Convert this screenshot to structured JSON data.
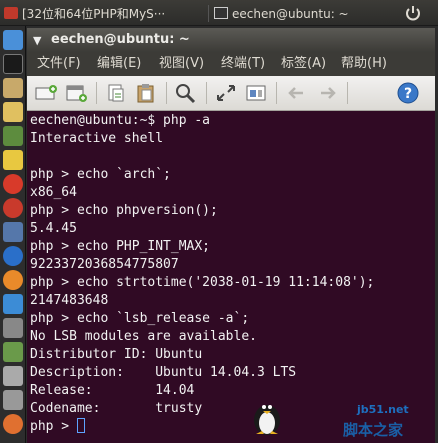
{
  "topbar": {
    "tab1_title": "[32位和64位PHP和MyS···",
    "tab2_title": "eechen@ubuntu: ~"
  },
  "window": {
    "title": "eechen@ubuntu: ~"
  },
  "menubar": {
    "items": [
      "文件(F)",
      "编辑(E)",
      "视图(V)",
      "终端(T)",
      "标签(A)",
      "帮助(H)"
    ]
  },
  "toolbar": {
    "icons": [
      "new-tab-icon",
      "new-window-icon",
      "copy-icon",
      "paste-icon",
      "search-icon",
      "fullscreen-icon",
      "restore-icon",
      "back-arrow-icon",
      "forward-arrow-icon",
      "help-icon"
    ]
  },
  "terminal": {
    "lines": [
      "eechen@ubuntu:~$ php -a",
      "Interactive shell",
      "",
      "php > echo `arch`;",
      "x86_64",
      "php > echo phpversion();",
      "5.4.45",
      "php > echo PHP_INT_MAX;",
      "9223372036854775807",
      "php > echo strtotime('2038-01-19 11:14:08');",
      "2147483648",
      "php > echo `lsb_release -a`;",
      "No LSB modules are available.",
      "Distributor ID: Ubuntu",
      "Description:    Ubuntu 14.04.3 LTS",
      "Release:        14.04",
      "Codename:       trusty",
      "php > "
    ]
  },
  "watermark": {
    "url": "jb51.net",
    "site": "脚本之家"
  },
  "colors": {
    "terminal_bg": "#300a24",
    "terminal_fg": "#f2f2f2",
    "titlebar": "#3c3b37",
    "toolbar": "#dcdad5"
  }
}
